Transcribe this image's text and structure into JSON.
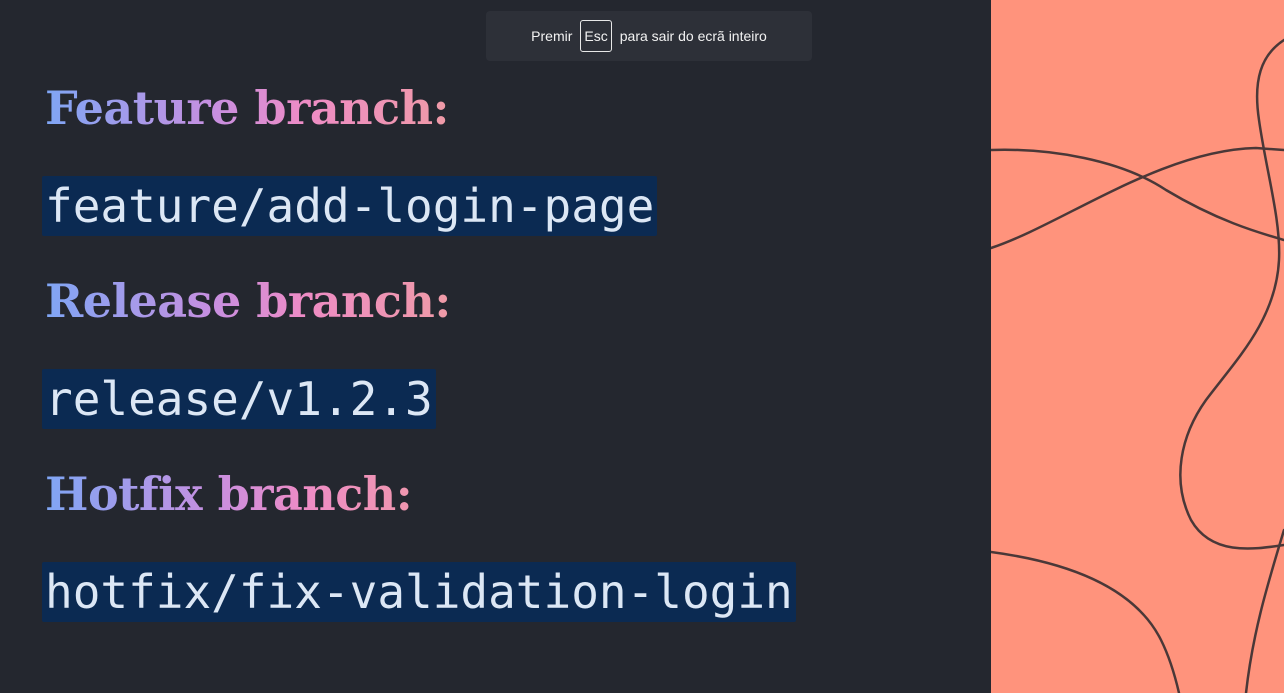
{
  "fullscreen_notice": {
    "before": "Premir",
    "key": "Esc",
    "after": "para sair do ecrã inteiro"
  },
  "sections": [
    {
      "heading": "Feature branch:",
      "example": "feature/add-login-page"
    },
    {
      "heading": "Release branch:",
      "example": "release/v1.2.3"
    },
    {
      "heading": "Hotfix branch:",
      "example": "hotfix/fix-validation-login"
    }
  ],
  "colors": {
    "slide_background": "#24272f",
    "deco_background": "#ff937c",
    "deco_line": "#4a3838",
    "code_background": "#0b2a52",
    "code_text": "#dce7f5",
    "heading_gradient_start": "#7fa6f5",
    "heading_gradient_end": "#ef9aa8"
  }
}
